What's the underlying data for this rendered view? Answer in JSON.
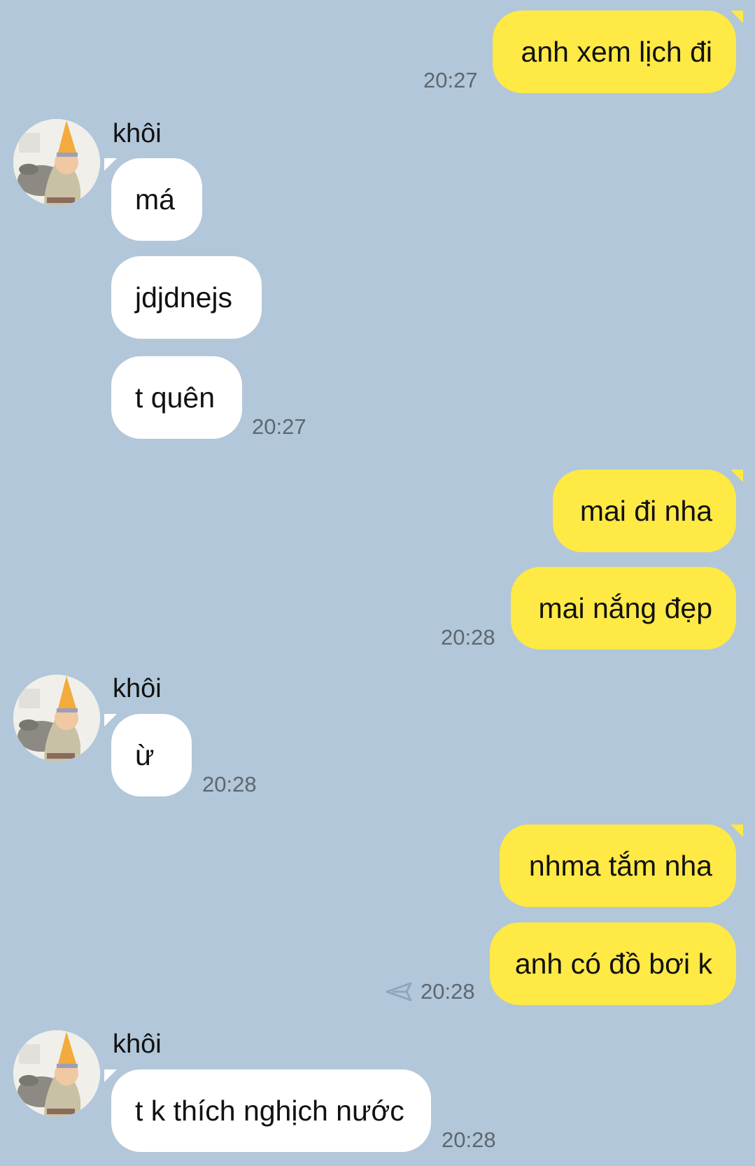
{
  "contact": {
    "name": "khôi"
  },
  "messages": [
    {
      "text": "anh xem lịch đi",
      "time": "20:27"
    },
    {
      "text": "má"
    },
    {
      "text": "jdjdnejs"
    },
    {
      "text": "t quên",
      "time": "20:27"
    },
    {
      "text": "mai đi nha"
    },
    {
      "text": "mai nắng đẹp",
      "time": "20:28"
    },
    {
      "text": "ừ",
      "time": "20:28"
    },
    {
      "text": "nhma tắm nha"
    },
    {
      "text": "anh có đồ bơi k",
      "time": "20:28"
    },
    {
      "text": "t k thích nghịch nước",
      "time": "20:28"
    }
  ],
  "colors": {
    "background": "#b2c7d9",
    "outgoing_bubble": "#fee945",
    "incoming_bubble": "#ffffff",
    "timestamp": "#5e6770"
  },
  "icons": {
    "send_status": "send-arrow-icon",
    "avatar": "contact-avatar"
  }
}
